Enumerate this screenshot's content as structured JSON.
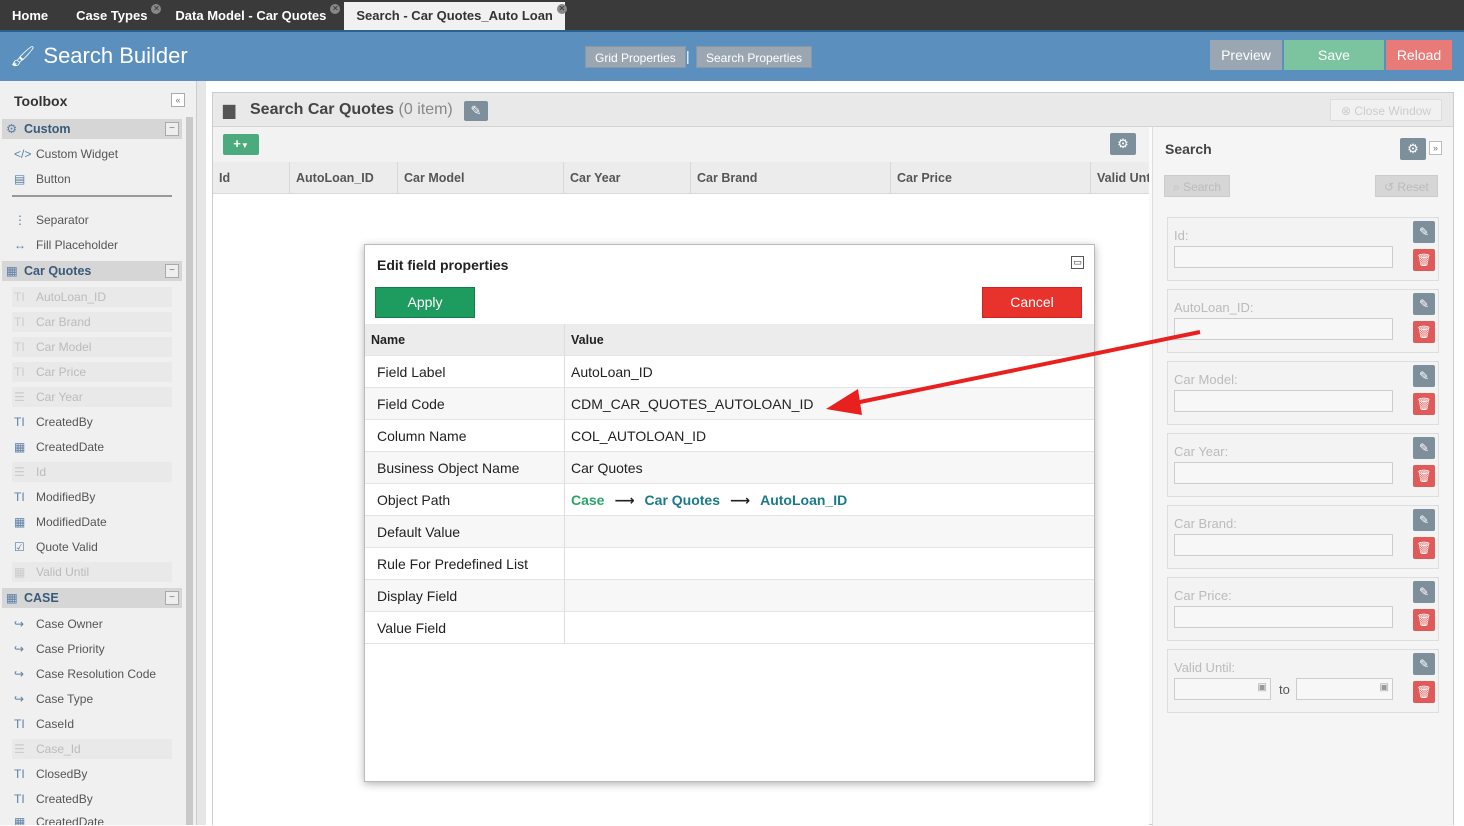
{
  "tabs": [
    {
      "label": "Home",
      "closable": false,
      "active": false
    },
    {
      "label": "Case Types",
      "closable": true,
      "active": false
    },
    {
      "label": "Data Model - Car Quotes",
      "closable": true,
      "active": false
    },
    {
      "label": "Search - Car Quotes_Auto Loan",
      "closable": true,
      "active": true
    }
  ],
  "header": {
    "title": "Search Builder",
    "grid_properties": "Grid Properties",
    "separator": "|",
    "search_properties": "Search Properties",
    "preview": "Preview",
    "save": "Save",
    "reload": "Reload",
    "colors": {
      "bar": "#5b8fbe",
      "preview": "#9aa7b2",
      "save": "#7cc4a0",
      "reload": "#e87a78"
    }
  },
  "toolbox": {
    "title": "Toolbox",
    "collapse_icon": "double-chevron-left-icon",
    "groups": [
      {
        "label": "Custom",
        "icon": "gears-icon"
      },
      {
        "label": "Car Quotes",
        "icon": "table-icon"
      },
      {
        "label": "CASE",
        "icon": "table-icon"
      }
    ],
    "custom_items": [
      "Custom Widget",
      "Button",
      "Separator",
      "Fill Placeholder"
    ],
    "car_quotes_items": [
      {
        "label": "AutoLoan_ID",
        "icon": "text-icon",
        "disabled": true
      },
      {
        "label": "Car Brand",
        "icon": "text-icon",
        "disabled": true
      },
      {
        "label": "Car Model",
        "icon": "text-icon",
        "disabled": true
      },
      {
        "label": "Car Price",
        "icon": "text-icon",
        "disabled": true
      },
      {
        "label": "Car Year",
        "icon": "list-icon",
        "disabled": true
      },
      {
        "label": "CreatedBy",
        "icon": "text-icon",
        "disabled": false
      },
      {
        "label": "CreatedDate",
        "icon": "calendar-icon",
        "disabled": false
      },
      {
        "label": "Id",
        "icon": "list-icon",
        "disabled": true
      },
      {
        "label": "ModifiedBy",
        "icon": "text-icon",
        "disabled": false
      },
      {
        "label": "ModifiedDate",
        "icon": "calendar-icon",
        "disabled": false
      },
      {
        "label": "Quote Valid",
        "icon": "checkbox-icon",
        "disabled": false
      },
      {
        "label": "Valid Until",
        "icon": "calendar-icon",
        "disabled": true
      }
    ],
    "case_items": [
      {
        "label": "Case Owner",
        "icon": "share-icon",
        "disabled": false
      },
      {
        "label": "Case Priority",
        "icon": "share-icon",
        "disabled": false
      },
      {
        "label": "Case Resolution Code",
        "icon": "share-icon",
        "disabled": false
      },
      {
        "label": "Case Type",
        "icon": "share-icon",
        "disabled": false
      },
      {
        "label": "CaseId",
        "icon": "text-icon",
        "disabled": false
      },
      {
        "label": "Case_Id",
        "icon": "list-icon",
        "disabled": true
      },
      {
        "label": "ClosedBy",
        "icon": "text-icon",
        "disabled": false
      },
      {
        "label": "CreatedBy",
        "icon": "text-icon",
        "disabled": false
      },
      {
        "label": "CreatedDate",
        "icon": "calendar-icon",
        "disabled": false
      }
    ]
  },
  "panel": {
    "title": "Search Car Quotes",
    "count": "(0 item)",
    "close_window": "Close Window",
    "add_button": "+",
    "columns": [
      "Id",
      "AutoLoan_ID",
      "Car Model",
      "Car Year",
      "Car Brand",
      "Car Price",
      "Valid Until"
    ]
  },
  "search": {
    "title": "Search",
    "search_button": "Search",
    "reset_button": "Reset",
    "fields": [
      "Id:",
      "AutoLoan_ID:",
      "Car Model:",
      "Car Year:",
      "Car Brand:",
      "Car Price:",
      "Valid Until:"
    ],
    "range_to": "to"
  },
  "dialog": {
    "title": "Edit field properties",
    "apply": "Apply",
    "cancel": "Cancel",
    "col_name": "Name",
    "col_value": "Value",
    "rows": [
      {
        "name": "Field Label",
        "value": "AutoLoan_ID"
      },
      {
        "name": "Field Code",
        "value": "CDM_CAR_QUOTES_AUTOLOAN_ID"
      },
      {
        "name": "Column Name",
        "value": "COL_AUTOLOAN_ID"
      },
      {
        "name": "Business Object Name",
        "value": "Car Quotes"
      },
      {
        "name": "Object Path",
        "value": ""
      },
      {
        "name": "Default Value",
        "value": ""
      },
      {
        "name": "Rule For Predefined List",
        "value": ""
      },
      {
        "name": "Display Field",
        "value": ""
      },
      {
        "name": "Value Field",
        "value": ""
      }
    ],
    "object_path": [
      "Case",
      "Car Quotes",
      "AutoLoan_ID"
    ],
    "path_arrow": "⟶"
  },
  "annotation": {
    "color": "#e8201e"
  }
}
